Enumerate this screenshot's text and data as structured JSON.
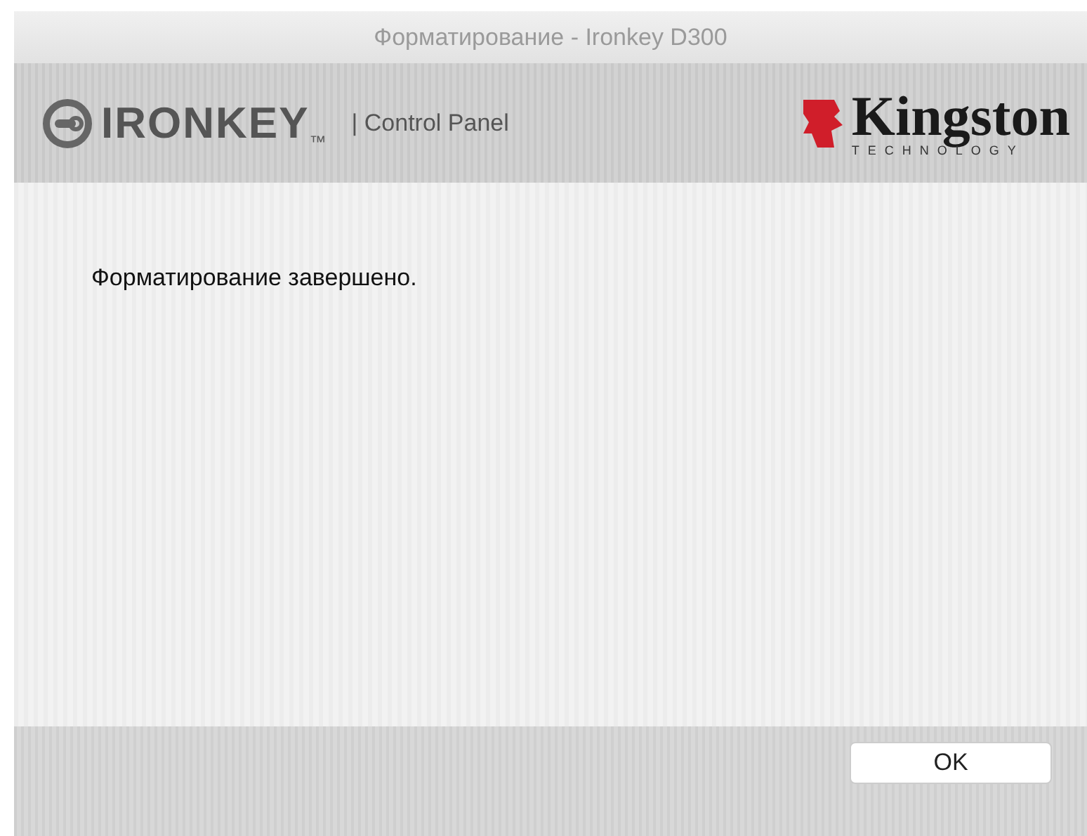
{
  "window": {
    "title": "Форматирование - Ironkey D300"
  },
  "header": {
    "brand": "IRONKEY",
    "trademark": "™",
    "product": "| Control Panel",
    "partner": "Kingston",
    "partner_tagline": "TECHNOLOGY"
  },
  "message": "Форматирование завершено.",
  "buttons": [
    "OK"
  ]
}
